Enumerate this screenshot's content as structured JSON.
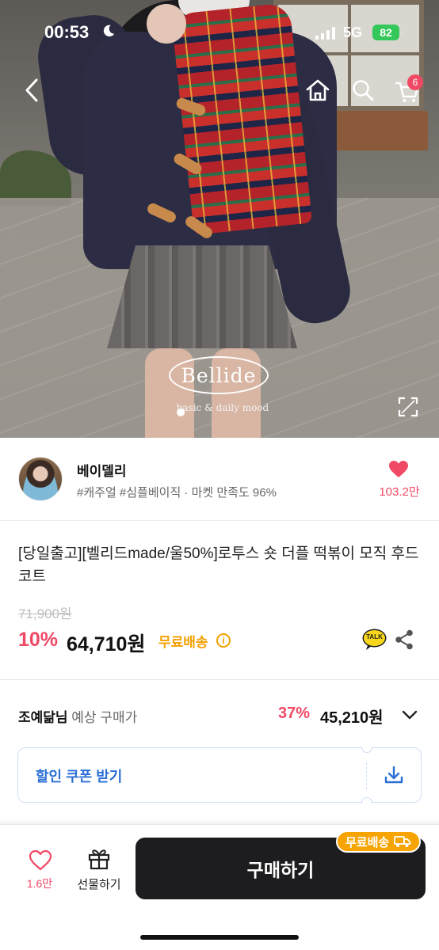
{
  "status_bar": {
    "time": "00:53",
    "network": "5G",
    "battery": "82"
  },
  "hero": {
    "brand": "Bellide",
    "tagline": "basic & daily mood",
    "cart_count": "6"
  },
  "seller": {
    "name": "베이델리",
    "tags": "#캐주얼 #심플베이직 · 마켓 만족도 96%",
    "likes": "103.2만"
  },
  "product": {
    "title": "[당일출고][벨리드made/울50%]로투스 숏 더플 떡볶이 모직 후드 코트",
    "original_price": "71,900원",
    "discount": "10%",
    "price": "64,710원",
    "free_shipping": "무료배송",
    "talk_label": "TALK"
  },
  "expected_price": {
    "buyer": "조예닮님",
    "label": "예상 구매가",
    "discount": "37%",
    "price": "45,210원"
  },
  "coupon": {
    "label": "할인 쿠폰 받기"
  },
  "bottom_bar": {
    "wish_count": "1.6만",
    "gift_label": "선물하기",
    "buy_label": "구매하기",
    "ship_badge": "무료배송"
  },
  "colors": {
    "accent_pink": "#ef4966",
    "shipping_orange": "#f4a000",
    "coupon_blue": "#2b6fd6",
    "buy_black": "#1d1d1f"
  }
}
